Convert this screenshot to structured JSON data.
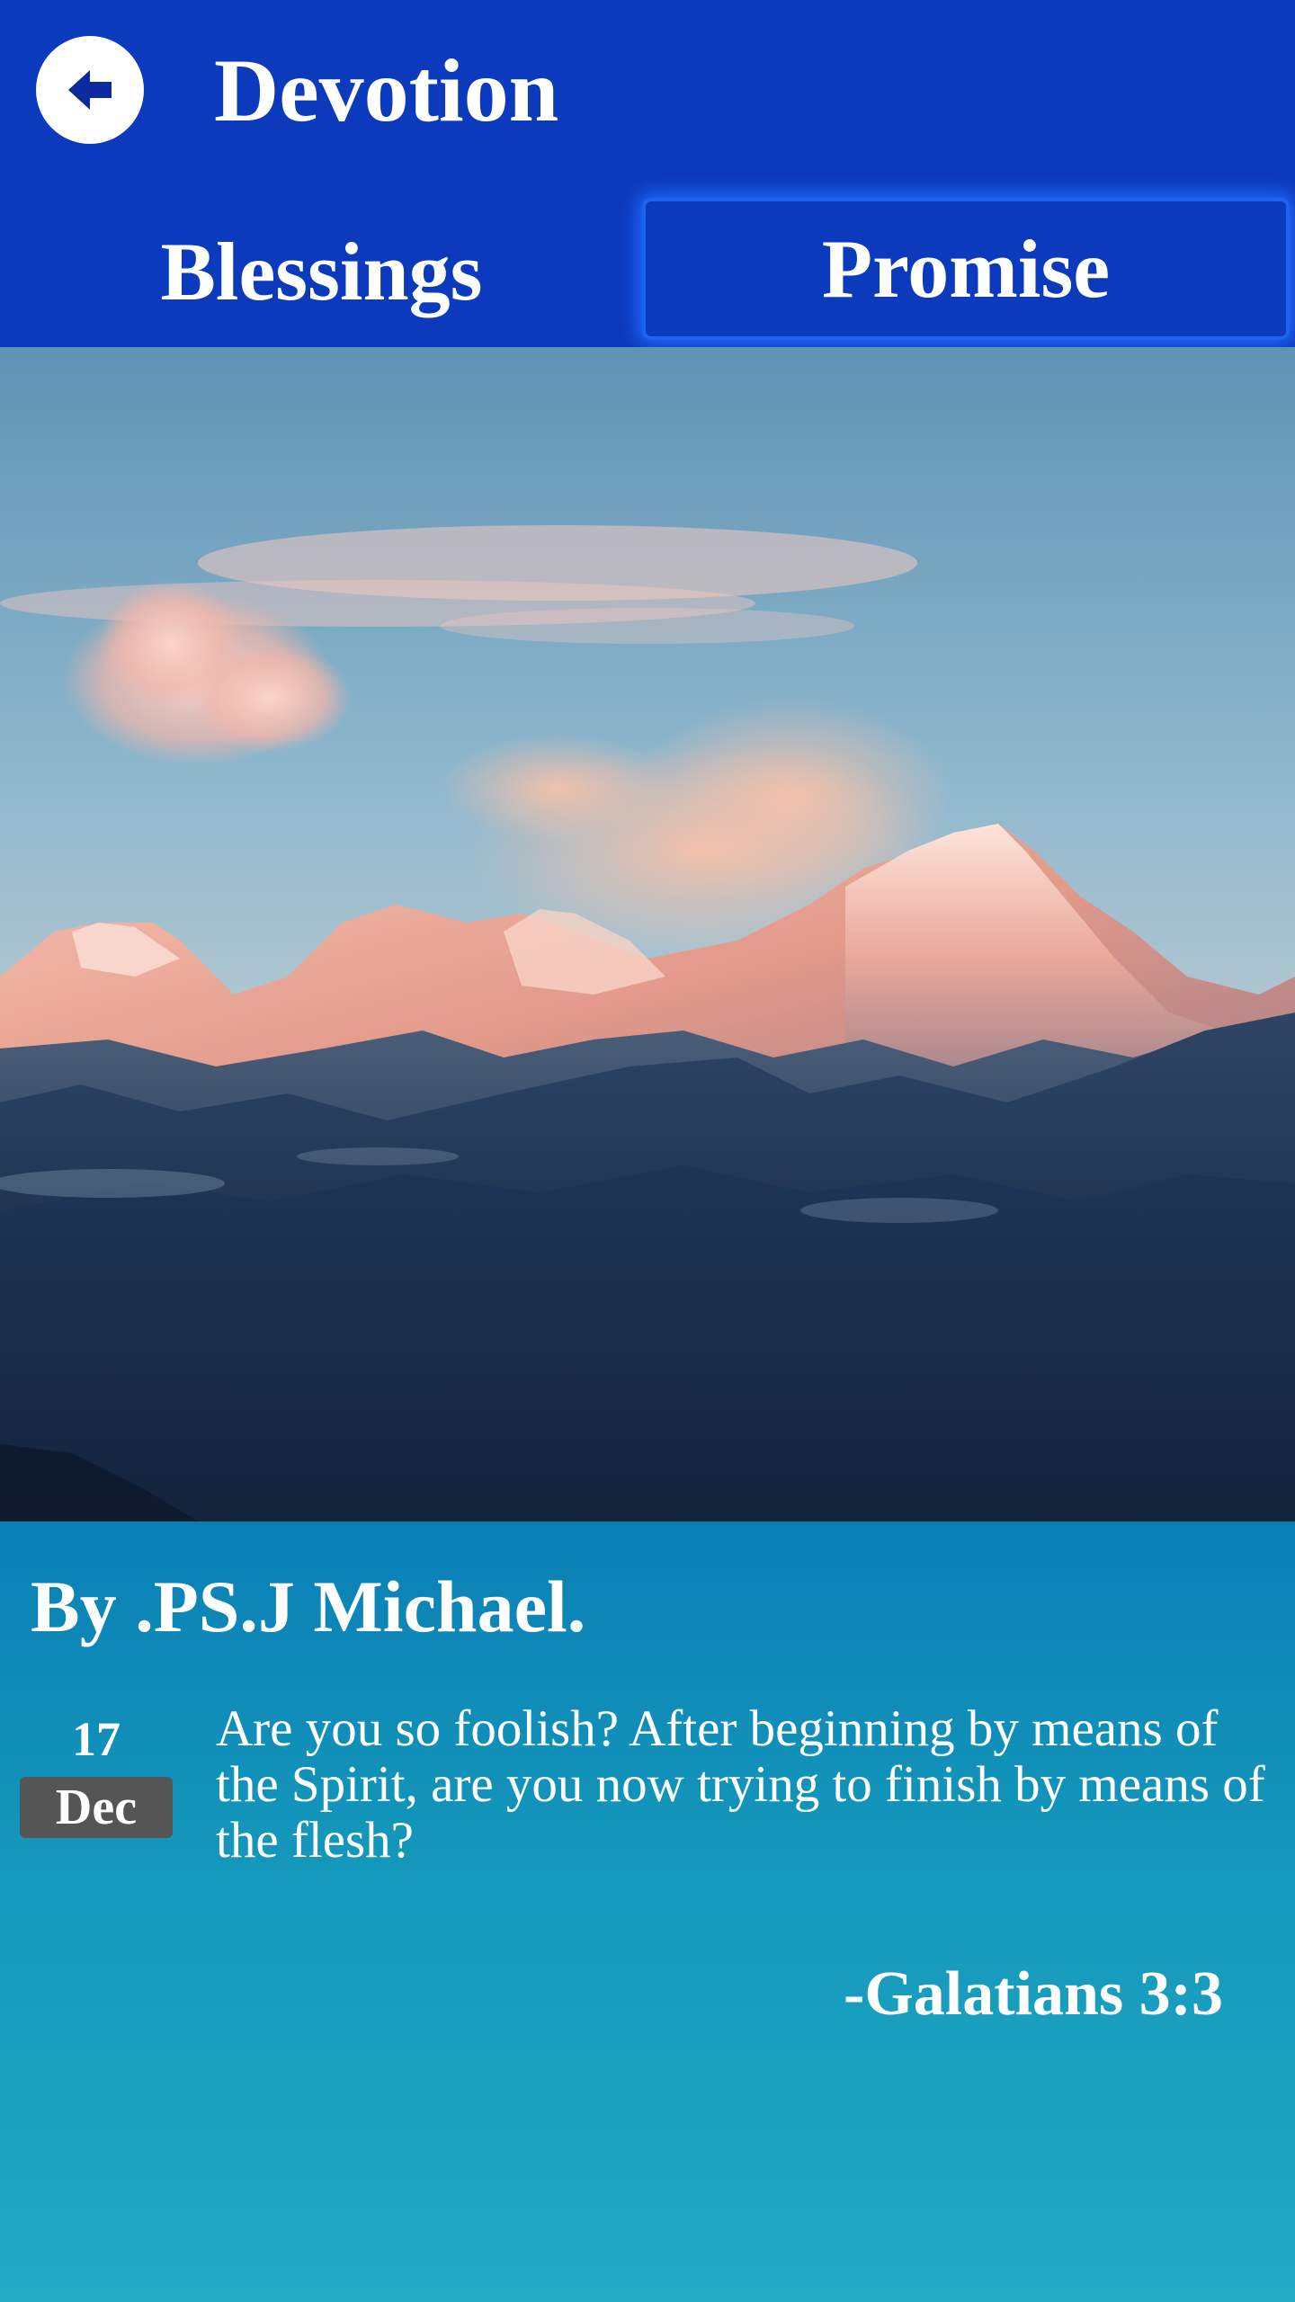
{
  "header": {
    "title": "Devotion",
    "back_icon": "arrow-left-icon"
  },
  "tabs": [
    {
      "label": "Blessings",
      "selected": false
    },
    {
      "label": "Promise",
      "selected": true
    }
  ],
  "colors": {
    "app_bar": "#0c3abd",
    "tab_highlight": "#1b64f0",
    "content_top": "#0a7fb6",
    "content_bottom": "#20aac4",
    "date_badge": "#555555",
    "text": "#ffffff"
  },
  "hero": {
    "icon": "mountain-landscape-image"
  },
  "devotion": {
    "author": "By .PS.J Michael.",
    "date_day": "17",
    "date_month": "Dec",
    "verse_text": "Are you so foolish? After beginning by means of the Spirit, are you now trying to finish by means of the flesh?",
    "reference": "-Galatians 3:3"
  }
}
